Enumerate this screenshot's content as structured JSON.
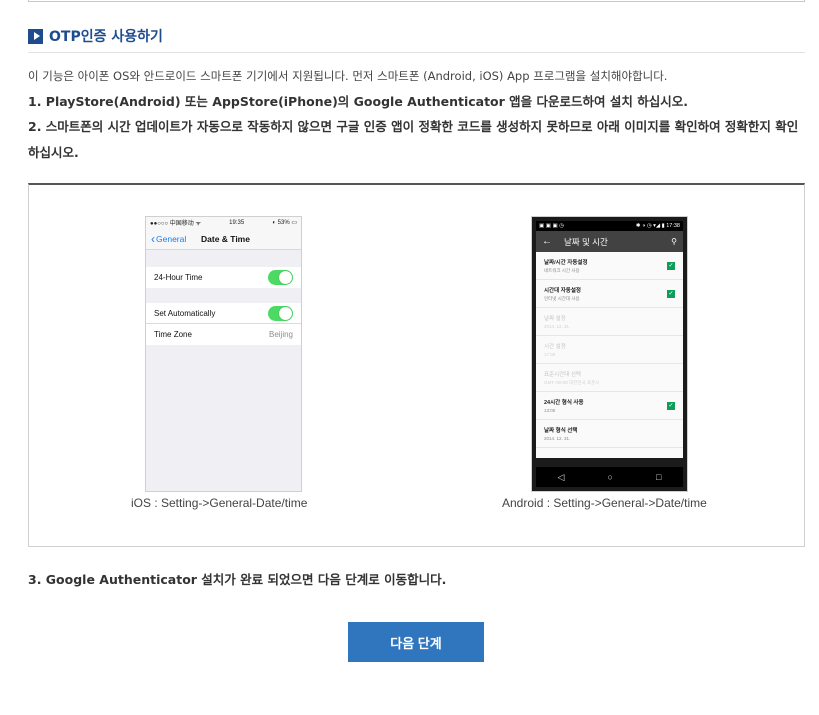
{
  "section": {
    "title": "OTP인증 사용하기",
    "description": "이 기능은 아이폰 OS와 안드로이드 스마트폰 기기에서 지원됩니다. 먼저 스마트폰 (Android, iOS) App 프로그램을 설치해야합니다.",
    "step1": "1. PlayStore(Android) 또는 AppStore(iPhone)의 Google Authenticator 앱을 다운로드하여 설치 하십시오.",
    "step2": "2. 스마트폰의 시간 업데이트가 자동으로 작동하지 않으면 구글 인증 앱이 정확한 코드를 생성하지 못하므로 아래 이미지를 확인하여 정확한지 확인하십시오.",
    "step3": "3. Google Authenticator 설치가 완료 되었으면 다음 단계로 이동합니다."
  },
  "ios": {
    "status_left": "●●○○○ 中国移动 ᯤ",
    "status_time": "19:35",
    "status_right": "◐ 53% ▭",
    "back_label": "General",
    "nav_title": "Date & Time",
    "row_24h": "24-Hour Time",
    "row_set_auto": "Set Automatically",
    "row_timezone": "Time Zone",
    "timezone_value": "Beijing",
    "caption": "iOS : Setting->General-Date/time"
  },
  "android": {
    "status_left": "▣ ▣ ▣ ◷",
    "status_right": "✱ ◑ ◷ ▾◢ ▮ 17:38",
    "bar_title": "날짜 및 시간",
    "items": [
      {
        "t1": "날짜/시간 자동설정",
        "t2": "네트워크 시간 사용"
      },
      {
        "t1": "시간대 자동설정",
        "t2": "인터넷 시간대 사용"
      },
      {
        "t1": "날짜 설정",
        "t2": "2014. 12. 31."
      },
      {
        "t1": "시간 설정",
        "t2": "17:38"
      },
      {
        "t1": "표준시간대 선택",
        "t2": "GMT+09:00 대한민국 표준시"
      },
      {
        "t1": "24시간 형식 사용",
        "t2": "13:00"
      },
      {
        "t1": "날짜 형식 선택",
        "t2": "2014. 12. 31."
      }
    ],
    "caption": "Android : Setting->General->Date/time"
  },
  "next_button_label": "다음 단계",
  "colors": {
    "accent": "#1e4c8f",
    "button": "#2f76bf",
    "ios_toggle": "#4cd964",
    "android_check": "#0f9d58"
  }
}
